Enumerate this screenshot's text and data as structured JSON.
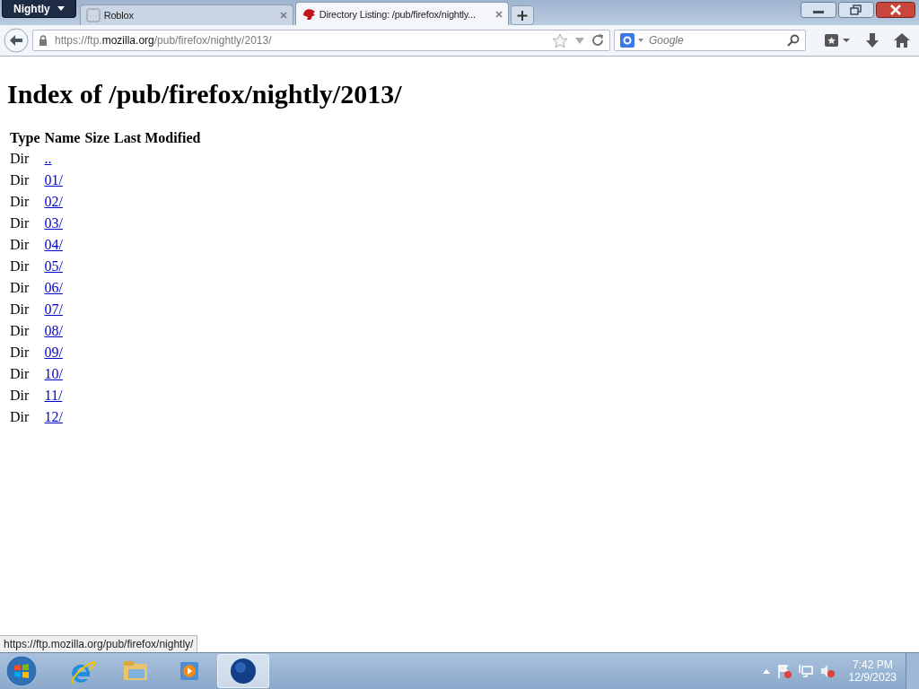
{
  "browser": {
    "app_menu": "Nightly",
    "tabs": [
      {
        "title": "Roblox",
        "selected": false
      },
      {
        "title": "Directory Listing: /pub/firefox/nightly...",
        "selected": true
      }
    ],
    "address": {
      "prefix": "https://ftp.",
      "domain": "mozilla.org",
      "path": "/pub/firefox/nightly/2013/"
    },
    "search": {
      "placeholder": "Google"
    }
  },
  "page": {
    "heading": "Index of /pub/firefox/nightly/2013/",
    "columns": [
      "Type",
      "Name",
      "Size",
      "Last Modified"
    ],
    "rows": [
      {
        "type": "Dir",
        "name": ".."
      },
      {
        "type": "Dir",
        "name": "01/"
      },
      {
        "type": "Dir",
        "name": "02/"
      },
      {
        "type": "Dir",
        "name": "03/"
      },
      {
        "type": "Dir",
        "name": "04/"
      },
      {
        "type": "Dir",
        "name": "05/"
      },
      {
        "type": "Dir",
        "name": "06/"
      },
      {
        "type": "Dir",
        "name": "07/"
      },
      {
        "type": "Dir",
        "name": "08/"
      },
      {
        "type": "Dir",
        "name": "09/"
      },
      {
        "type": "Dir",
        "name": "10/"
      },
      {
        "type": "Dir",
        "name": "11/"
      },
      {
        "type": "Dir",
        "name": "12/"
      }
    ]
  },
  "status_link": "https://ftp.mozilla.org/pub/firefox/nightly/",
  "taskbar": {
    "apps": [
      {
        "kind": "ie",
        "selected": false
      },
      {
        "kind": "explorer",
        "selected": false
      },
      {
        "kind": "media",
        "selected": false
      },
      {
        "kind": "nightly",
        "selected": true
      }
    ],
    "clock": {
      "time": "7:42 PM",
      "date": "12/9/2023"
    }
  }
}
